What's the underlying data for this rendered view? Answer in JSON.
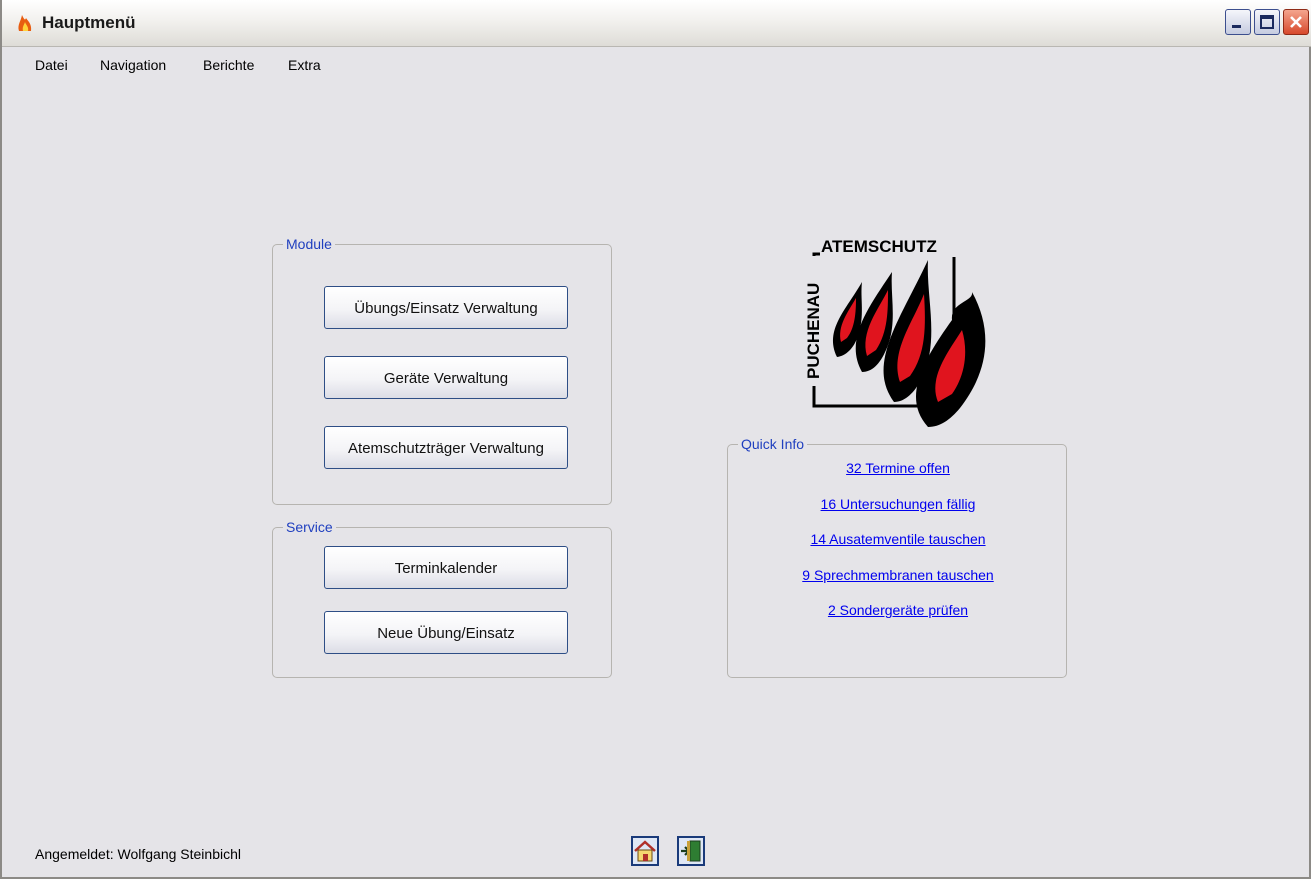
{
  "window": {
    "title": "Hauptmenü",
    "controls": [
      "minimize-icon",
      "maximize-icon",
      "close-icon"
    ]
  },
  "menu": {
    "datei": "Datei",
    "navigation": "Navigation",
    "berichte": "Berichte",
    "extra": "Extra"
  },
  "module": {
    "label": "Module",
    "buttons": [
      "Übungs/Einsatz Verwaltung",
      "Geräte Verwaltung",
      "Atemschutzträger Verwaltung"
    ]
  },
  "service": {
    "label": "Service",
    "buttons": [
      "Terminkalender",
      "Neue Übung/Einsatz"
    ]
  },
  "logo": {
    "top_text": "ATEMSCHUTZ",
    "side_text": "PUCHENAU"
  },
  "quick_info": {
    "label": "Quick Info",
    "links": [
      "32 Termine offen",
      "16 Untersuchungen fällig",
      "14 Ausatemventile tauschen",
      "9 Sprechmembranen tauschen",
      "2 Sondergeräte prüfen"
    ]
  },
  "status": {
    "logged_in": "Angemeldet: Wolfgang Steinbichl"
  },
  "toolbar": {
    "icons": [
      "home-icon",
      "exit-door-icon"
    ]
  },
  "colors": {
    "group_label": "#1f3fbf",
    "link": "#0000ee",
    "flame_red": "#e0141e",
    "button_border": "#2e4e86"
  }
}
